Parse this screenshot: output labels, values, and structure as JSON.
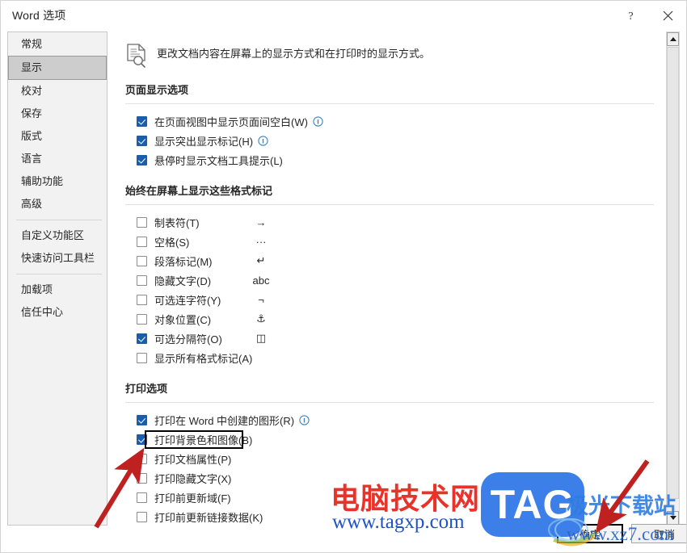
{
  "window": {
    "title": "Word 选项",
    "help_label": "?",
    "close_label": "✕",
    "help_icon": "question-mark-icon",
    "close_icon": "close-icon"
  },
  "sidebar": {
    "items": [
      {
        "label": "常规",
        "selected": false,
        "sep_after": false
      },
      {
        "label": "显示",
        "selected": true,
        "sep_after": false
      },
      {
        "label": "校对",
        "selected": false,
        "sep_after": false
      },
      {
        "label": "保存",
        "selected": false,
        "sep_after": false
      },
      {
        "label": "版式",
        "selected": false,
        "sep_after": false
      },
      {
        "label": "语言",
        "selected": false,
        "sep_after": false
      },
      {
        "label": "辅助功能",
        "selected": false,
        "sep_after": false
      },
      {
        "label": "高级",
        "selected": false,
        "sep_after": true
      },
      {
        "label": "自定义功能区",
        "selected": false,
        "sep_after": false
      },
      {
        "label": "快速访问工具栏",
        "selected": false,
        "sep_after": true
      },
      {
        "label": "加载项",
        "selected": false,
        "sep_after": false
      },
      {
        "label": "信任中心",
        "selected": false,
        "sep_after": false
      }
    ]
  },
  "main": {
    "intro_text": "更改文档内容在屏幕上的显示方式和在打印时的显示方式。",
    "intro_icon": "document-preview-icon",
    "sections": [
      {
        "title": "页面显示选项",
        "options": [
          {
            "label": "在页面视图中显示页面间空白(W)",
            "accel": "W",
            "checked": true,
            "info": true,
            "mark": ""
          },
          {
            "label": "显示突出显示标记(H)",
            "accel": "H",
            "checked": true,
            "info": true,
            "mark": ""
          },
          {
            "label": "悬停时显示文档工具提示(L)",
            "accel": "L",
            "checked": true,
            "info": false,
            "mark": ""
          }
        ]
      },
      {
        "title": "始终在屏幕上显示这些格式标记",
        "options": [
          {
            "label": "制表符(T)",
            "accel": "T",
            "checked": false,
            "info": false,
            "mark": "→",
            "mark_name": "tab-mark-glyph"
          },
          {
            "label": "空格(S)",
            "accel": "S",
            "checked": false,
            "info": false,
            "mark": "···",
            "mark_name": "space-mark-glyph"
          },
          {
            "label": "段落标记(M)",
            "accel": "M",
            "checked": false,
            "info": false,
            "mark": "↵",
            "mark_name": "paragraph-mark-glyph"
          },
          {
            "label": "隐藏文字(D)",
            "accel": "D",
            "checked": false,
            "info": false,
            "mark": "abc",
            "mark_name": "hidden-text-mark-glyph"
          },
          {
            "label": "可选连字符(Y)",
            "accel": "Y",
            "checked": false,
            "info": false,
            "mark": "¬",
            "mark_name": "optional-hyphen-mark-glyph"
          },
          {
            "label": "对象位置(C)",
            "accel": "C",
            "checked": false,
            "info": false,
            "mark": "⚓",
            "mark_name": "anchor-mark-glyph"
          },
          {
            "label": "可选分隔符(O)",
            "accel": "O",
            "checked": true,
            "info": false,
            "mark": "◫",
            "mark_name": "optional-break-mark-glyph"
          },
          {
            "label": "显示所有格式标记(A)",
            "accel": "A",
            "checked": false,
            "info": false,
            "mark": "",
            "mark_name": ""
          }
        ]
      },
      {
        "title": "打印选项",
        "options": [
          {
            "label": "打印在 Word 中创建的图形(R)",
            "accel": "R",
            "checked": true,
            "info": true,
            "mark": ""
          },
          {
            "label": "打印背景色和图像(B)",
            "accel": "B",
            "checked": true,
            "info": false,
            "mark": "",
            "highlighted": true
          },
          {
            "label": "打印文档属性(P)",
            "accel": "P",
            "checked": false,
            "info": false,
            "mark": ""
          },
          {
            "label": "打印隐藏文字(X)",
            "accel": "X",
            "checked": false,
            "info": false,
            "mark": ""
          },
          {
            "label": "打印前更新域(F)",
            "accel": "F",
            "checked": false,
            "info": false,
            "mark": ""
          },
          {
            "label": "打印前更新链接数据(K)",
            "accel": "K",
            "checked": false,
            "info": false,
            "mark": ""
          }
        ]
      }
    ]
  },
  "buttons": {
    "ok": "确定",
    "cancel": "取消"
  },
  "scrollbar": {
    "up_icon": "scroll-up-arrow-icon",
    "down_icon": "scroll-down-arrow-icon"
  },
  "watermark": {
    "cn_text": "电脑技术网",
    "url_text": "www.tagxp.com",
    "tag_text": "TAG",
    "overlay_cn": "极光下载站",
    "overlay_url": "www.xz7.com"
  },
  "annotations": {
    "arrow1_name": "red-arrow-pointing-to-print-background-checkbox",
    "arrow2_name": "red-arrow-pointing-to-ok-button",
    "arrow_color": "#c02020"
  }
}
